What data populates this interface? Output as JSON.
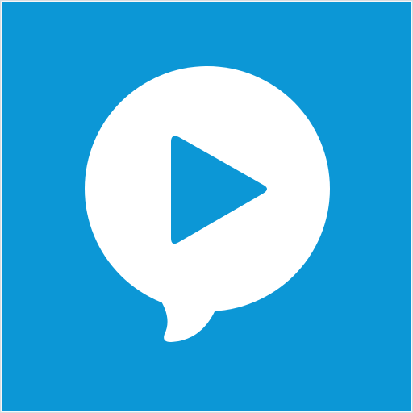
{
  "icon": {
    "name": "video-chat-app-icon",
    "glyph": "speech-bubble-play-icon",
    "colors": {
      "background": "#0C97D6",
      "bubble": "#FFFFFF",
      "play": "#0C97D6",
      "frame_edge": "#D9DDE0"
    }
  }
}
